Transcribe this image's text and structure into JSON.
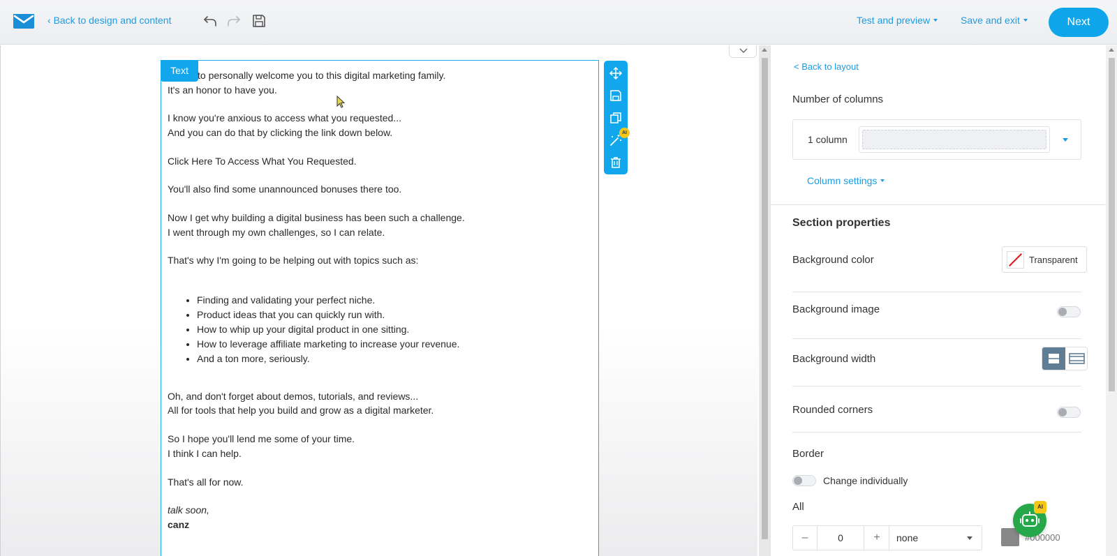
{
  "topbar": {
    "back_label": "Back to design and content",
    "test_preview_label": "Test and preview",
    "save_exit_label": "Save and exit",
    "next_label": "Next"
  },
  "canvas": {
    "block_tag": "Text",
    "ai_badge": "AI",
    "email": {
      "p1": [
        "to personally welcome you to this digital marketing family.",
        "It's an honor to have you."
      ],
      "p2": [
        "I know you're anxious to access what you requested...",
        "And you can do that by clicking the link down below."
      ],
      "p3": "Click Here To Access What You Requested.",
      "p4": "You'll also find some unannounced bonuses there too.",
      "p5": [
        "Now I get why building a digital business has been such a challenge.",
        "I went through my own challenges, so I can relate."
      ],
      "p6": "That's why I'm going to be helping out with topics such as:",
      "bullets": [
        "Finding and validating your perfect niche.",
        "Product ideas that you can quickly run with.",
        "How to whip up your digital product in one sitting.",
        "How to leverage affiliate marketing to increase your revenue.",
        "And a ton more, seriously."
      ],
      "p7": [
        "Oh, and don't forget about demos, tutorials, and reviews...",
        "All for tools that help you build and grow as a digital marketer."
      ],
      "p8": [
        "So I hope you'll lend me some of your time.",
        "I think I can help."
      ],
      "p9": "That's all for now.",
      "signoff": "talk soon,",
      "signature": "canz"
    }
  },
  "panel": {
    "back_layout": "< Back to layout",
    "num_columns_label": "Number of columns",
    "columns_value": "1 column",
    "column_settings": "Column settings",
    "section_properties": "Section properties",
    "bg_color_label": "Background color",
    "bg_color_value": "Transparent",
    "bg_image_label": "Background image",
    "bg_width_label": "Background width",
    "rounded_label": "Rounded corners",
    "border_label": "Border",
    "change_individually": "Change individually",
    "all_label": "All",
    "border_width": "0",
    "border_style": "none",
    "border_color_placeholder": "#000000",
    "stepper_minus": "–",
    "stepper_plus": "+"
  },
  "ai_assistant": {
    "badge": "AI"
  },
  "colors": {
    "accent": "#0ea5ea",
    "link": "#1c9be0",
    "bot": "#25a74a",
    "badge": "#f6c717"
  }
}
